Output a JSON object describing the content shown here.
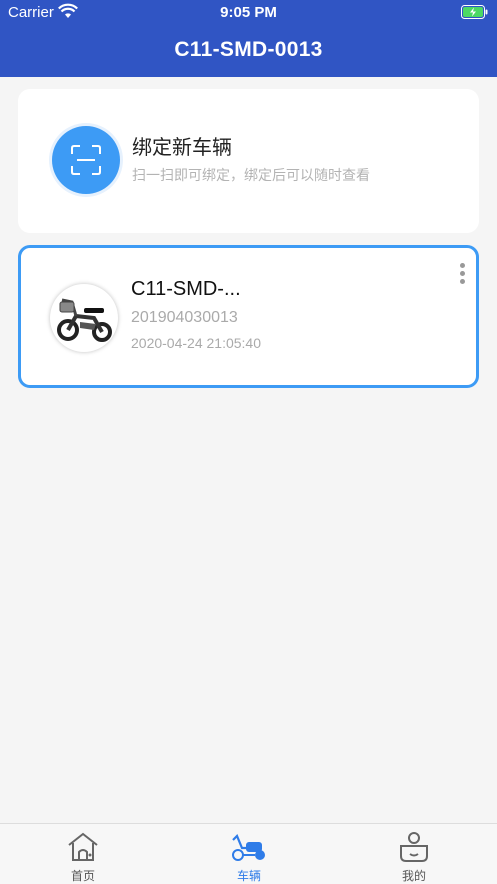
{
  "status_bar": {
    "carrier": "Carrier",
    "time": "9:05 PM"
  },
  "header": {
    "title": "C11-SMD-0013"
  },
  "bind_card": {
    "title": "绑定新车辆",
    "subtitle": "扫一扫即可绑定，绑定后可以随时查看",
    "icon": "scan-icon"
  },
  "vehicles": [
    {
      "name": "C11-SMD-...",
      "serial": "201904030013",
      "bound_at": "2020-04-24 21:05:40"
    }
  ],
  "tabbar": {
    "items": [
      {
        "label": "首页",
        "icon": "home-icon",
        "active": false
      },
      {
        "label": "车辆",
        "icon": "scooter-icon",
        "active": true
      },
      {
        "label": "我的",
        "icon": "user-icon",
        "active": false
      }
    ]
  },
  "colors": {
    "header": "#3055c4",
    "accent": "#3d9bf5",
    "active_tab": "#2f7ce8"
  }
}
